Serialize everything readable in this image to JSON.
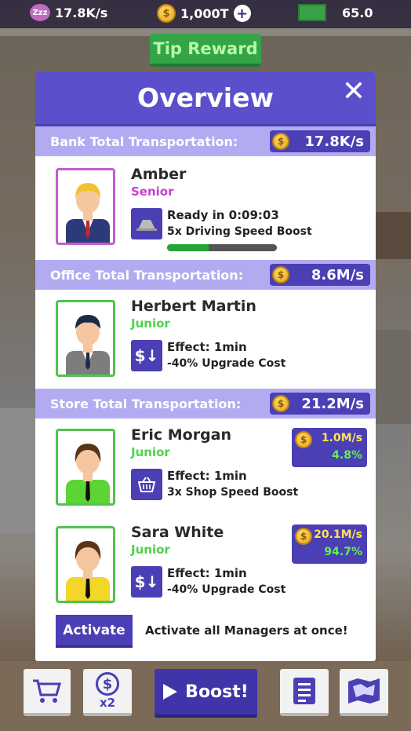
{
  "top_bar": {
    "gem_rate": "17.8K/s",
    "coins": "1,000T",
    "cash": "65.0"
  },
  "tip_reward": "Tip Reward",
  "overview": {
    "title": "Overview",
    "close": "✕",
    "sections": [
      {
        "label": "Bank Total Transportation:",
        "rate": "17.8K/s",
        "managers": [
          {
            "name": "Amber",
            "rank": "Senior",
            "skill_line1": "Ready in 0:09:03",
            "skill_line2": "5x Driving Speed Boost",
            "progress": 0.38
          }
        ]
      },
      {
        "label": "Office Total Transportation:",
        "rate": "8.6M/s",
        "managers": [
          {
            "name": "Herbert Martin",
            "rank": "Junior",
            "skill_line1": "Effect: 1min",
            "skill_line2": "-40% Upgrade Cost"
          }
        ]
      },
      {
        "label": "Store Total Transportation:",
        "rate": "21.2M/s",
        "managers": [
          {
            "name": "Eric Morgan",
            "rank": "Junior",
            "skill_line1": "Effect: 1min",
            "skill_line2": "3x Shop Speed Boost",
            "earn_rate": "1.0M/s",
            "earn_pct": "4.8%"
          },
          {
            "name": "Sara White",
            "rank": "Junior",
            "skill_line1": "Effect: 1min",
            "skill_line2": "-40% Upgrade Cost",
            "earn_rate": "20.1M/s",
            "earn_pct": "94.7%"
          }
        ]
      }
    ],
    "activate_label": "Activate",
    "activate_desc": "Activate all Managers at once!"
  },
  "bottom_bar": {
    "multiplier": "x2",
    "boost_label": "Boost!"
  },
  "colors": {
    "header_purple": "#5b4fcc",
    "section_lavender": "#b3abf1",
    "badge_indigo": "#4a3fb5",
    "senior_pink": "#c53fd0",
    "junior_green": "#4fd14f"
  }
}
